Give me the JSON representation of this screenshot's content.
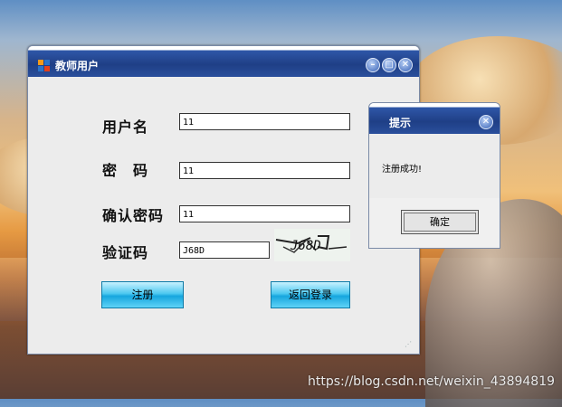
{
  "main_window": {
    "title": "教师用户",
    "icon": "app-grid-icon",
    "buttons": [
      "minimize-icon",
      "maximize-icon",
      "close-icon"
    ]
  },
  "form": {
    "username_label": "用户名",
    "username_value": "11",
    "password_label": "密　码",
    "password_value": "11",
    "confirm_label": "确认密码",
    "confirm_value": "11",
    "captcha_label": "验证码",
    "captcha_value": "J68D",
    "captcha_image_text": "J68D"
  },
  "actions": {
    "register_label": "注册",
    "back_label": "返回登录"
  },
  "dialog": {
    "title": "提示",
    "message": "注册成功!",
    "ok_label": "确定"
  },
  "watermark": "https://blog.csdn.net/weixin_43894819",
  "colors": {
    "titlebar": "#1f3f86",
    "button_blue": "#16a6de",
    "window_bg": "#ececec"
  }
}
